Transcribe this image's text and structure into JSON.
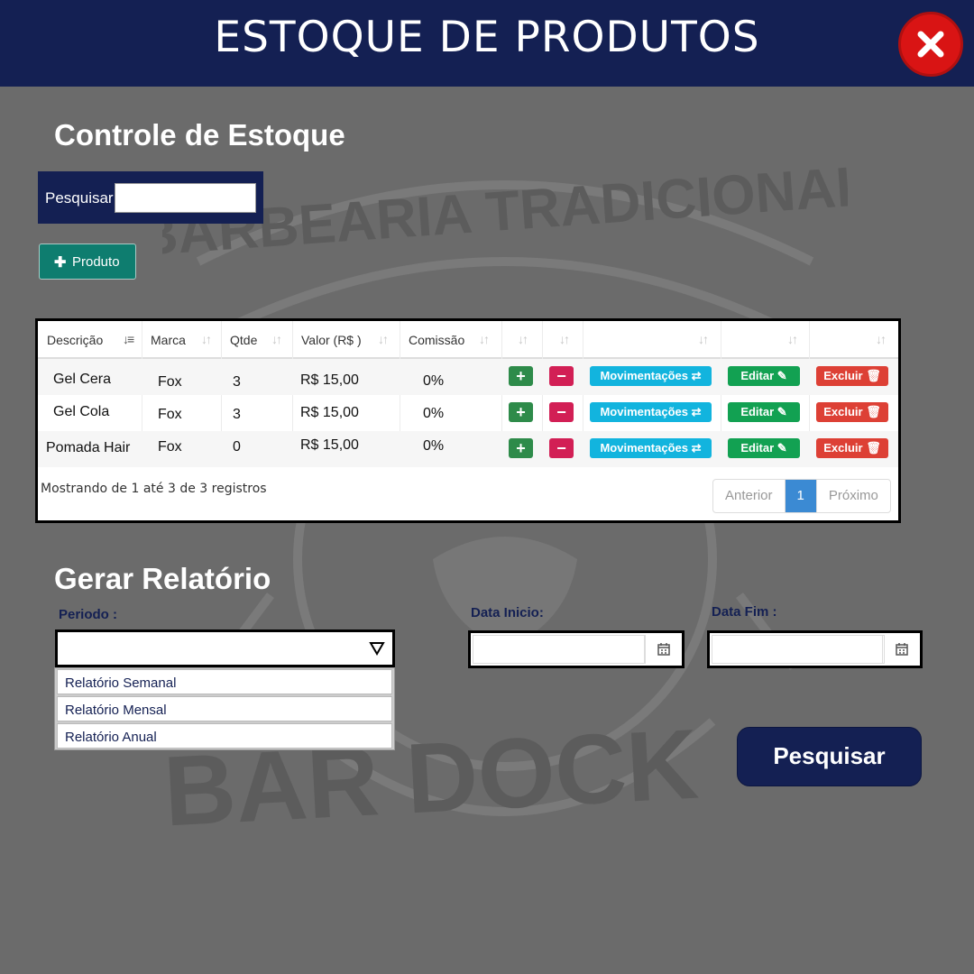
{
  "header": {
    "title": "ESTOQUE DE PRODUTOS",
    "close_icon": "close-icon"
  },
  "background": {
    "logo_top_text": "BARBEARIA TRADICIONAL",
    "logo_bottom_text": "BAR DOCK"
  },
  "stock": {
    "title": "Controle de Estoque",
    "search_label": "Pesquisar",
    "search_value": "",
    "add_button": "Produto",
    "table": {
      "headers": [
        "Descrição",
        "Marca",
        "Qtde",
        "Valor (R$ )",
        "Comissão",
        "",
        "",
        "",
        "",
        ""
      ],
      "rows": [
        {
          "descricao": "Gel Cera",
          "marca": "Fox",
          "qtde": "3",
          "valor": "R$ 15,00",
          "comissao": "0%"
        },
        {
          "descricao": "Gel Cola",
          "marca": "Fox",
          "qtde": "3",
          "valor": "R$ 15,00",
          "comissao": "0%"
        },
        {
          "descricao": "Pomada Hair",
          "marca": "Fox",
          "qtde": "0",
          "valor": "R$ 15,00",
          "comissao": "0%"
        }
      ],
      "actions": {
        "plus": "+",
        "minus": "−",
        "movimentacoes": "Movimentações ⇄",
        "editar": "Editar ✎",
        "excluir": "Excluir 🗑"
      }
    },
    "footer_info": "Mostrando de 1 até 3 de 3 registros",
    "pagination": {
      "prev": "Anterior",
      "current": "1",
      "next": "Próximo"
    }
  },
  "report": {
    "title": "Gerar Relatório",
    "period_label": "Periodo",
    "period_value": "",
    "period_options": [
      "Relatório Semanal",
      "Relatório Mensal",
      "Relatório Anual"
    ],
    "start_label": "Data Inicio",
    "end_label": "Data Fim",
    "start_value": "",
    "end_value": "",
    "search_button": "Pesquisar"
  },
  "colors": {
    "navy": "#142053",
    "teal": "#0e7d6f",
    "close_red": "#d91414",
    "info_blue": "#12b4de",
    "success_green": "#12a152",
    "danger_red": "#dd4035",
    "pink": "#d21f55"
  }
}
